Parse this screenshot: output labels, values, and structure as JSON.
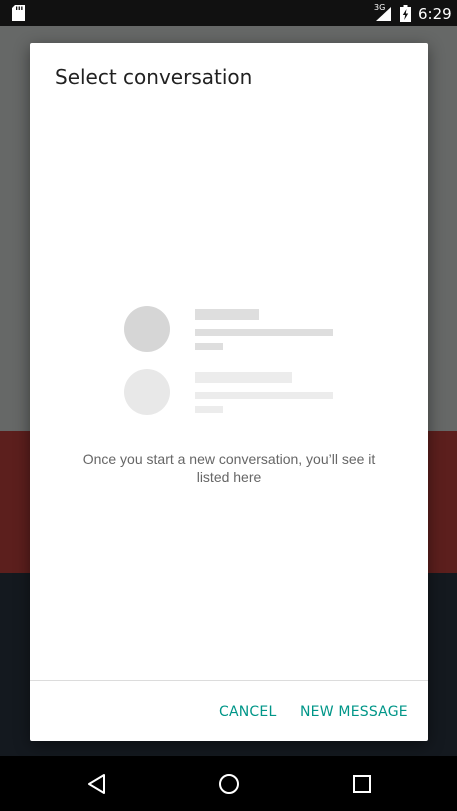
{
  "status_bar": {
    "sd_icon": "sd-card-icon",
    "network_type": "3G",
    "signal_icon": "signal-icon",
    "battery_icon": "battery-charging-icon",
    "time": "6:29"
  },
  "dialog": {
    "title": "Select conversation",
    "empty_state": {
      "illustration_icon": "conversation-list-placeholder",
      "message": "Once you start a new conversation, you’ll see it listed here"
    },
    "actions": {
      "cancel_label": "CANCEL",
      "new_message_label": "NEW MESSAGE"
    }
  },
  "nav_bar": {
    "back_icon": "back-icon",
    "home_icon": "home-icon",
    "recents_icon": "recents-icon"
  },
  "colors": {
    "accent": "#009688",
    "scrim_top": "#666867",
    "scrim_middle": "#5c1f1d",
    "scrim_bottom": "#14191f",
    "placeholder": "#e0e0e0"
  }
}
